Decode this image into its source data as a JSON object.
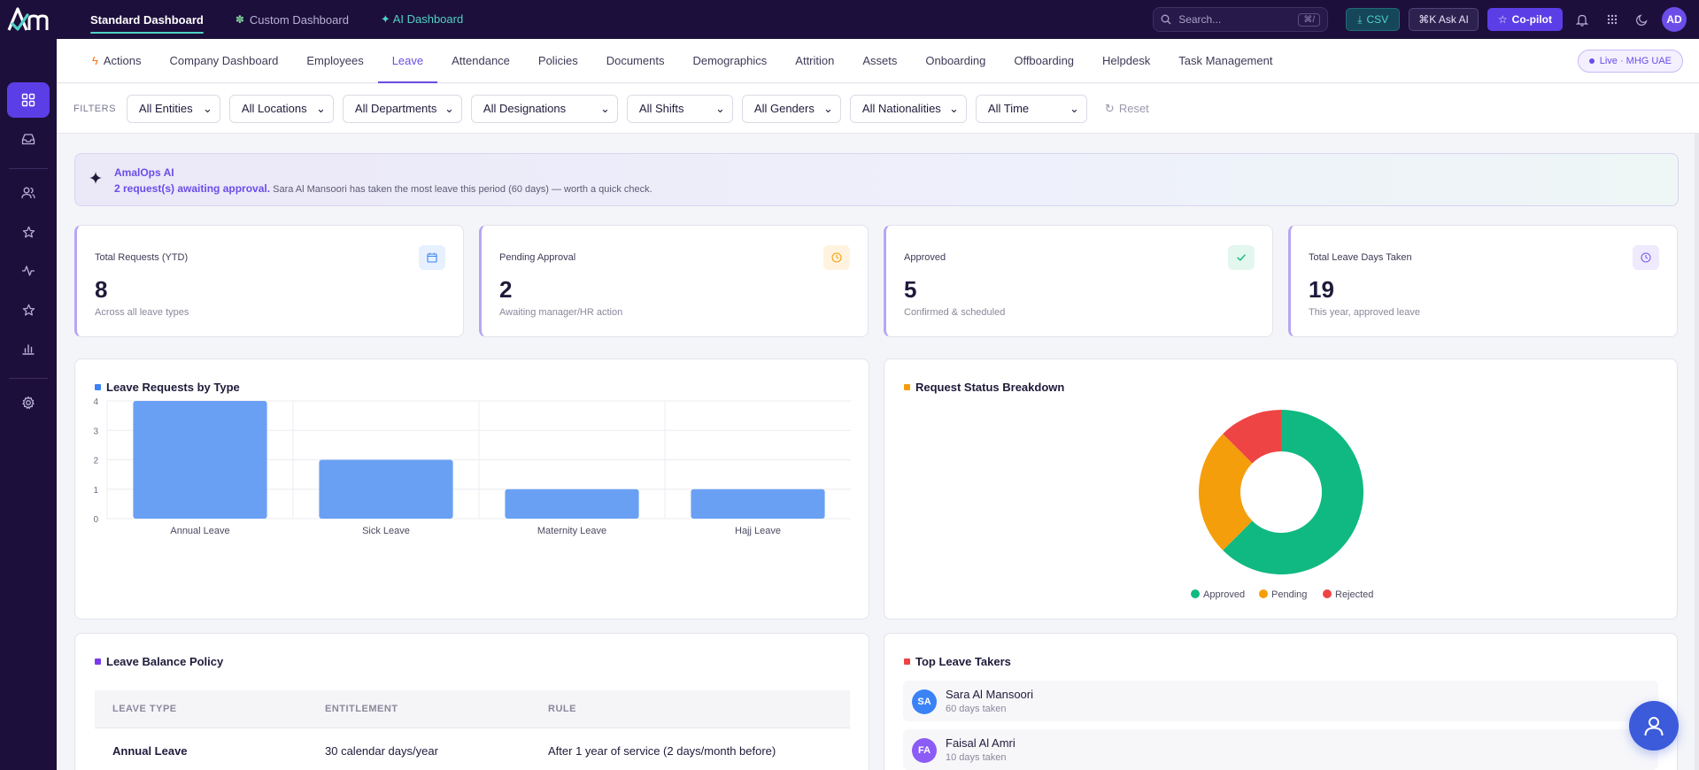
{
  "topbar": {
    "tabs": [
      {
        "label": "Standard Dashboard"
      },
      {
        "label": "Custom Dashboard"
      },
      {
        "label": "✦ AI Dashboard"
      }
    ],
    "search_placeholder": "Search...",
    "search_shortcut": "⌘/",
    "csv_label": "CSV",
    "ask_label": "⌘K Ask AI",
    "copilot_label": "Co-pilot",
    "avatar_initials": "AD"
  },
  "subnav": {
    "tabs": [
      {
        "label": "Actions"
      },
      {
        "label": "Company Dashboard"
      },
      {
        "label": "Employees"
      },
      {
        "label": "Leave"
      },
      {
        "label": "Attendance"
      },
      {
        "label": "Policies"
      },
      {
        "label": "Documents"
      },
      {
        "label": "Demographics"
      },
      {
        "label": "Attrition"
      },
      {
        "label": "Assets"
      },
      {
        "label": "Onboarding"
      },
      {
        "label": "Offboarding"
      },
      {
        "label": "Helpdesk"
      },
      {
        "label": "Task Management"
      }
    ],
    "active_tab": "Leave",
    "live_badge": "Live · MHG UAE"
  },
  "filters": {
    "label": "FILTERS",
    "selects": [
      {
        "value": "All Entities"
      },
      {
        "value": "All Locations"
      },
      {
        "value": "All Departments"
      },
      {
        "value": "All Designations"
      },
      {
        "value": "All Shifts"
      },
      {
        "value": "All Genders"
      },
      {
        "value": "All Nationalities"
      },
      {
        "value": "All Time"
      }
    ],
    "reset_label": "Reset"
  },
  "ai_banner": {
    "title": "AmalOps AI",
    "highlight": "2 request(s) awaiting approval.",
    "message": "Sara Al Mansoori has taken the most leave this period (60 days) — worth a quick check."
  },
  "kpis": [
    {
      "label": "Total Requests (YTD)",
      "value": "8",
      "sub": "Across all leave types",
      "icon": "calendar-icon",
      "color": "#3b82f6",
      "bg": "#e6f0ff"
    },
    {
      "label": "Pending Approval",
      "value": "2",
      "sub": "Awaiting manager/HR action",
      "icon": "clock-icon",
      "color": "#f59e0b",
      "bg": "#fff3e0"
    },
    {
      "label": "Approved",
      "value": "5",
      "sub": "Confirmed & scheduled",
      "icon": "check-icon",
      "color": "#10b981",
      "bg": "#e3f7ef"
    },
    {
      "label": "Total Leave Days Taken",
      "value": "19",
      "sub": "This year, approved leave",
      "icon": "clock-icon",
      "color": "#7c5cf0",
      "bg": "#efeafd"
    }
  ],
  "charts_titles": {
    "bar": "Leave Requests by Type",
    "donut": "Request Status Breakdown"
  },
  "chart_data": [
    {
      "type": "bar",
      "title": "Leave Requests by Type",
      "categories": [
        "Annual Leave",
        "Sick Leave",
        "Maternity Leave",
        "Hajj Leave"
      ],
      "values": [
        4,
        2,
        1,
        1
      ],
      "yticks": [
        0,
        1,
        2,
        3,
        4
      ],
      "ylim": [
        0,
        4
      ],
      "color": "#6aa0f4",
      "grid": true
    },
    {
      "type": "pie",
      "title": "Request Status Breakdown",
      "categories": [
        "Approved",
        "Pending",
        "Rejected"
      ],
      "values": [
        5,
        2,
        1
      ],
      "colors": [
        "#10b981",
        "#f59e0b",
        "#ef4444"
      ],
      "donut": true,
      "legend": "bottom"
    }
  ],
  "policy": {
    "title": "Leave Balance Policy",
    "columns": [
      "LEAVE TYPE",
      "ENTITLEMENT",
      "RULE"
    ],
    "rows": [
      {
        "type": "Annual Leave",
        "entitlement": "30 calendar days/year",
        "rule": "After 1 year of service (2 days/month before)"
      }
    ]
  },
  "top_takers": {
    "title": "Top Leave Takers",
    "items": [
      {
        "initials": "SA",
        "name": "Sara Al Mansoori",
        "days": "60 days taken",
        "color": "#3b82f6"
      },
      {
        "initials": "FA",
        "name": "Faisal Al Amri",
        "days": "10 days taken",
        "color": "#8b5cf6"
      }
    ]
  },
  "colors": {
    "sidebar_bg": "#1d0f3b",
    "accent": "#6b4de8",
    "teal": "#4fd1c5"
  }
}
